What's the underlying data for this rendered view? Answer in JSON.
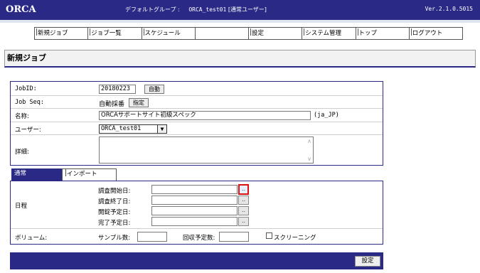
{
  "header": {
    "logo": "ORCA",
    "group_label": "デフォルトグループ :",
    "user": "ORCA_test01",
    "user_role": "[通常ユーザー]",
    "version": "Ver.2.1.0.5015"
  },
  "nav": {
    "items": [
      {
        "label": "新規ジョブ"
      },
      {
        "label": "ジョブ一覧"
      },
      {
        "label": "スケジュール"
      },
      {
        "label": ""
      },
      {
        "label": "設定"
      },
      {
        "label": "システム管理"
      },
      {
        "label": "トップ"
      },
      {
        "label": "ログアウト"
      }
    ]
  },
  "page": {
    "title": "新規ジョブ"
  },
  "form": {
    "jobid_label": "JobID:",
    "jobid_value": "20180223",
    "jobid_auto_button": "自動",
    "jobseq_label": "Job Seq:",
    "jobseq_value": "自動採番",
    "jobseq_specify_button": "指定",
    "name_label": "名称:",
    "name_value": "ORCAサポートサイト初級スペック",
    "name_locale": "(ja_JP)",
    "user_label": "ユーザー:",
    "user_selected": "ORCA_test01",
    "details_label": "詳細:",
    "details_value": ""
  },
  "tabs": {
    "active": "通常",
    "import": "インポート"
  },
  "schedule": {
    "label": "日程",
    "rows": [
      {
        "label": "調査開始日:",
        "value": "",
        "button": ".."
      },
      {
        "label": "調査終了日:",
        "value": "",
        "button": ".."
      },
      {
        "label": "開錠予定日:",
        "value": "",
        "button": ".."
      },
      {
        "label": "完了予定日:",
        "value": "",
        "button": ".."
      }
    ]
  },
  "volume": {
    "label": "ボリューム:",
    "sample_label": "サンプル数:",
    "sample_value": "",
    "collect_label": "回収予定数:",
    "collect_value": "",
    "screening_label": "スクリーニング",
    "screening_checked": false
  },
  "footer": {
    "save_button": "設定"
  },
  "colors": {
    "brand_navy": "#2a2a86",
    "highlight_red": "#e01010"
  }
}
